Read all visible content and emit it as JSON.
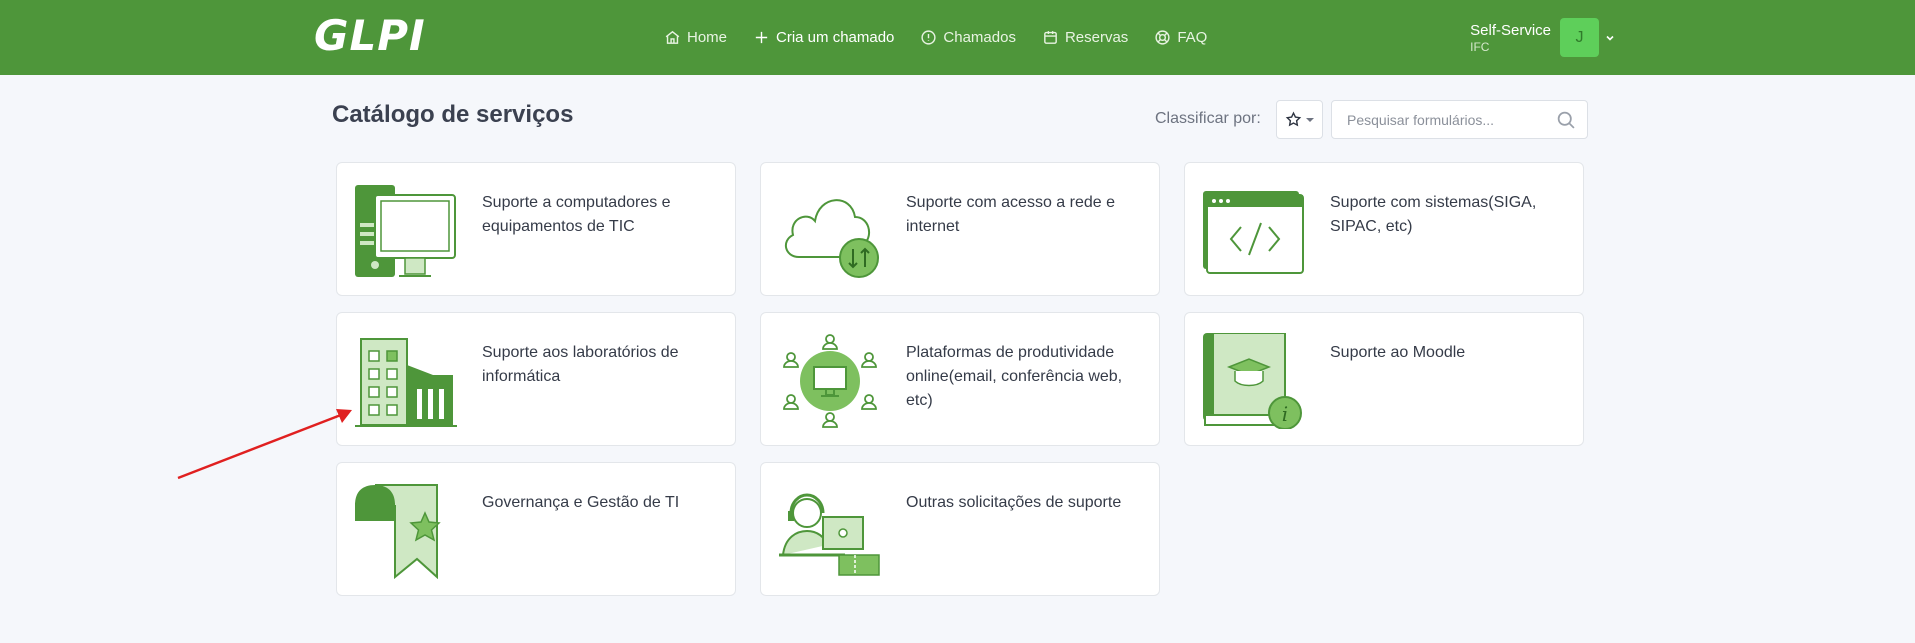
{
  "app": {
    "logo_text": "GLPI"
  },
  "nav": {
    "items": [
      {
        "label": "Home",
        "icon": "home-icon"
      },
      {
        "label": "Cria um chamado",
        "icon": "plus-icon"
      },
      {
        "label": "Chamados",
        "icon": "alert-circle-icon"
      },
      {
        "label": "Reservas",
        "icon": "calendar-icon"
      },
      {
        "label": "FAQ",
        "icon": "lifebuoy-icon"
      }
    ]
  },
  "user": {
    "profile": "Self-Service",
    "entity": "IFC",
    "avatar_initial": "J"
  },
  "page": {
    "title": "Catálogo de serviços",
    "sort_label": "Classificar por:",
    "search_placeholder": "Pesquisar formulários..."
  },
  "catalog": {
    "items": [
      {
        "label": "Suporte a computadores e equipamentos de TIC",
        "icon": "computer-icon"
      },
      {
        "label": "Suporte com acesso a rede e internet",
        "icon": "cloud-network-icon"
      },
      {
        "label": "Suporte com sistemas(SIGA, SIPAC, etc)",
        "icon": "code-window-icon"
      },
      {
        "label": "Suporte aos laboratórios de informática",
        "icon": "building-icon"
      },
      {
        "label": "Plataformas de produtividade online(email, conferência web, etc)",
        "icon": "collaboration-icon"
      },
      {
        "label": "Suporte ao Moodle",
        "icon": "book-info-icon"
      },
      {
        "label": "Governança e Gestão de TI",
        "icon": "award-ribbon-icon"
      },
      {
        "label": "Outras solicitações de suporte",
        "icon": "support-agent-icon"
      }
    ]
  },
  "colors": {
    "header": "#4e963a",
    "accent": "#5aa83f",
    "light_accent": "#cfe8c4",
    "annotation_arrow": "#e02020"
  }
}
